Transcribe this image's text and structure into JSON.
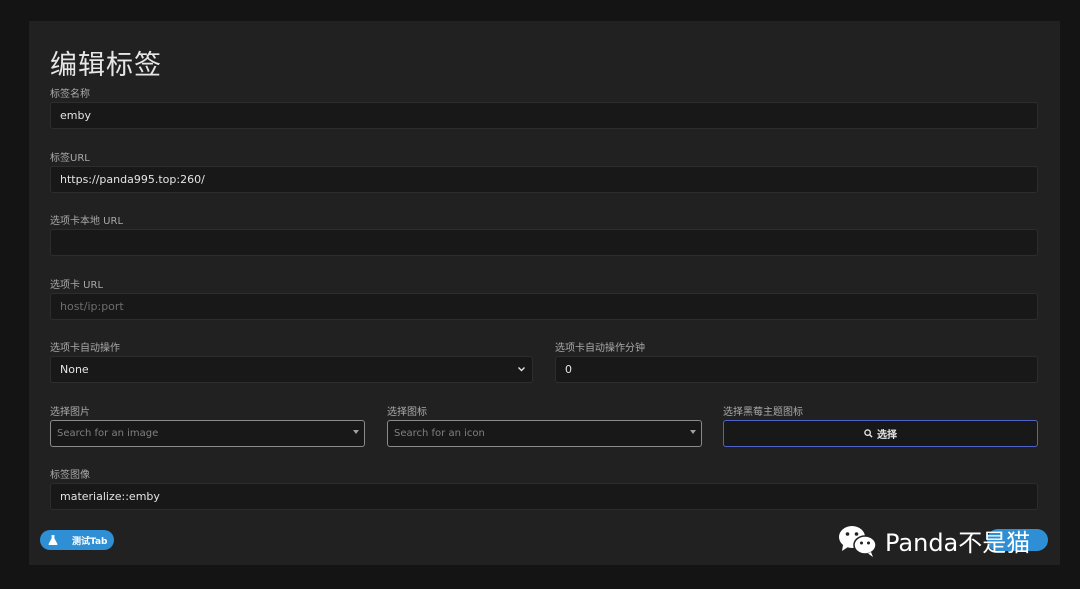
{
  "page": {
    "title": "编辑标签"
  },
  "fields": {
    "tag_name": {
      "label": "标签名称",
      "value": "emby"
    },
    "tag_url": {
      "label": "标签URL",
      "value": "https://panda995.top:260/"
    },
    "local_url": {
      "label": "选项卡本地 URL",
      "value": ""
    },
    "tab_url": {
      "label": "选项卡 URL",
      "placeholder": "host/ip:port"
    },
    "auto_action": {
      "label": "选项卡自动操作",
      "value": "None"
    },
    "auto_minutes": {
      "label": "选项卡自动操作分钟",
      "value": "0"
    },
    "image": {
      "label": "选择图片",
      "placeholder": "Search for an image"
    },
    "icon": {
      "label": "选择图标",
      "placeholder": "Search for an icon"
    },
    "theme_icon": {
      "label": "选择黑莓主题图标",
      "button_label": "选择"
    },
    "tag_image": {
      "label": "标签图像",
      "value": "materialize::emby"
    }
  },
  "actions": {
    "test_tab": "测试Tab"
  },
  "watermark": {
    "text": "Panda不是猫"
  },
  "colors": {
    "background": "#141414",
    "panel": "#212121",
    "accent": "#2f8fd4",
    "button_border": "#4f62c9"
  },
  "icons": [
    "search-icon",
    "flask-icon",
    "chevron-down-icon",
    "caret-down-icon",
    "wechat-icon"
  ]
}
